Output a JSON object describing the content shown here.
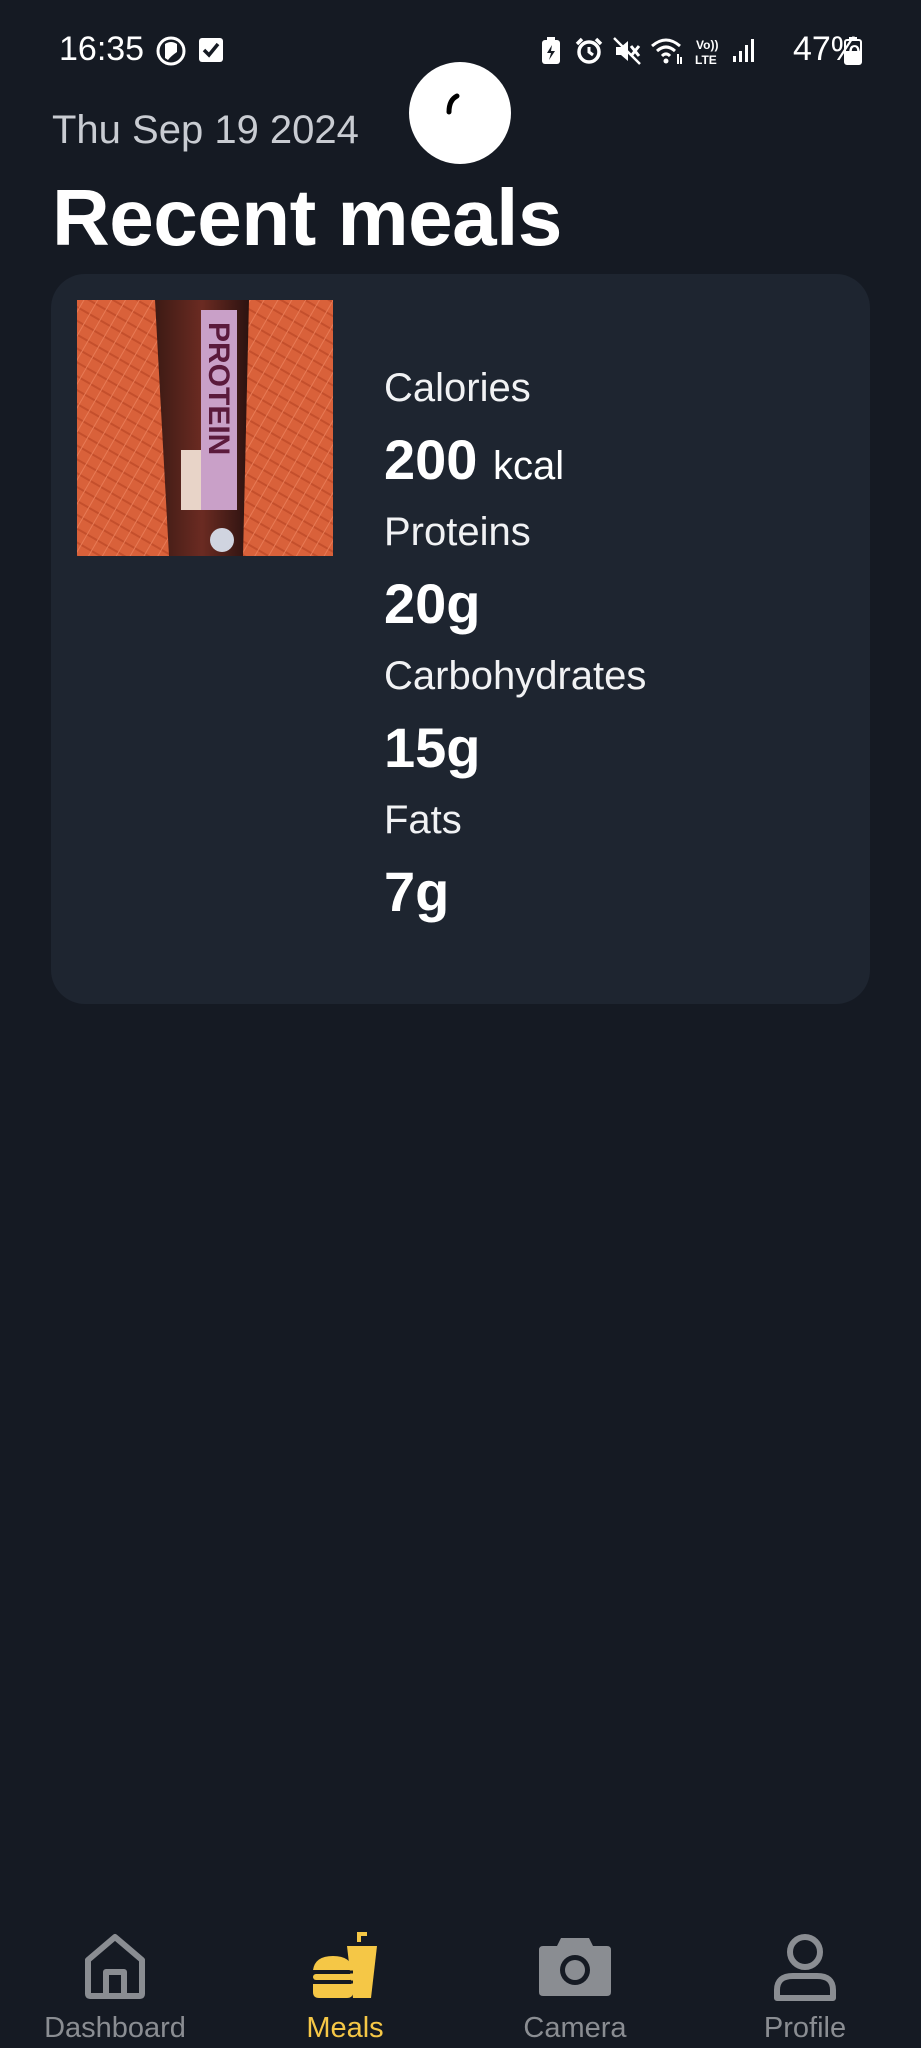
{
  "status_bar": {
    "time": "16:35",
    "battery": "47%",
    "icons": [
      "face-icon",
      "checkbox-icon",
      "battery-saver-icon",
      "alarm-icon",
      "mute-icon",
      "wifi-icon",
      "volte-icon",
      "signal-icon",
      "battery-icon"
    ]
  },
  "header": {
    "date": "Thu Sep 19 2024",
    "title": "Recent meals"
  },
  "meal": {
    "image_alt": "protein bar",
    "photo_text": "PROTEIN",
    "calories_label": "Calories",
    "calories_value": "200",
    "calories_unit": "kcal",
    "proteins_label": "Proteins",
    "proteins_value": "20g",
    "carbs_label": "Carbohydrates",
    "carbs_value": "15g",
    "fats_label": "Fats",
    "fats_value": "7g"
  },
  "nav": {
    "items": [
      {
        "label": "Dashboard",
        "icon": "home-icon"
      },
      {
        "label": "Meals",
        "icon": "burger-drink-icon"
      },
      {
        "label": "Camera",
        "icon": "camera-icon"
      },
      {
        "label": "Profile",
        "icon": "person-icon"
      }
    ],
    "active_index": 1,
    "active_color": "#f5c746",
    "inactive_color": "#8a8d92"
  }
}
